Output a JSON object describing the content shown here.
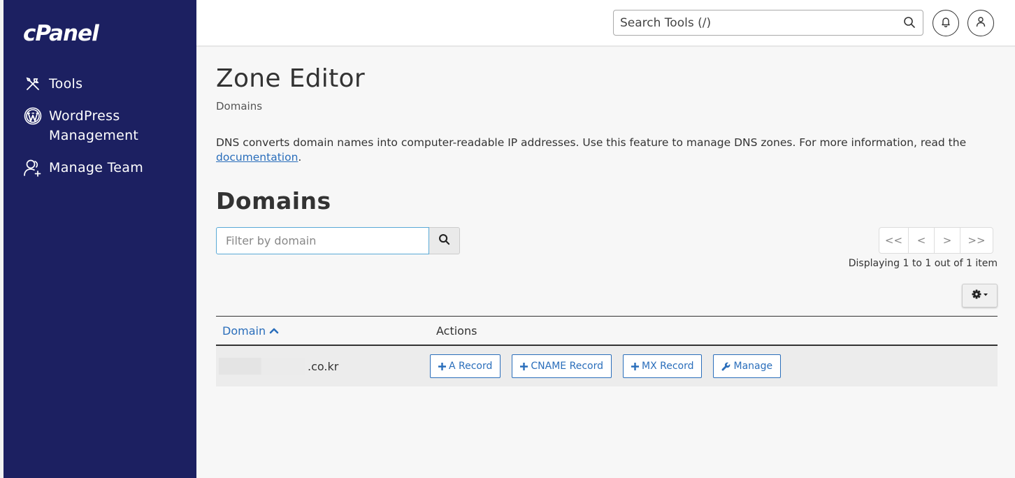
{
  "sidebar": {
    "logo": "cPanel",
    "items": [
      {
        "label": "Tools",
        "icon": "tools-icon"
      },
      {
        "label": "WordPress Management",
        "icon": "wordpress-icon"
      },
      {
        "label": "Manage Team",
        "icon": "manage-team-icon"
      }
    ]
  },
  "topbar": {
    "search_placeholder": "Search Tools (/)"
  },
  "page": {
    "title": "Zone Editor",
    "breadcrumb": "Domains",
    "description": "DNS converts domain names into computer-readable IP addresses. Use this feature to manage DNS zones. For more information, read the",
    "description_link": "documentation",
    "description_end": ".",
    "section_title": "Domains"
  },
  "filter": {
    "placeholder": "Filter by domain"
  },
  "pagination": {
    "first": "<<",
    "prev": "<",
    "next": ">",
    "last": ">>",
    "info": "Displaying 1 to 1 out of 1 item"
  },
  "table": {
    "headers": {
      "domain": "Domain",
      "actions": "Actions"
    },
    "rows": [
      {
        "domain_suffix": ".co.kr"
      }
    ],
    "actions": {
      "a_record": "A Record",
      "cname_record": "CNAME Record",
      "mx_record": "MX Record",
      "manage": "Manage"
    }
  },
  "colors": {
    "sidebar_bg": "#1c2061",
    "link": "#2a6ebb",
    "focus_border": "#5aa9d6"
  }
}
